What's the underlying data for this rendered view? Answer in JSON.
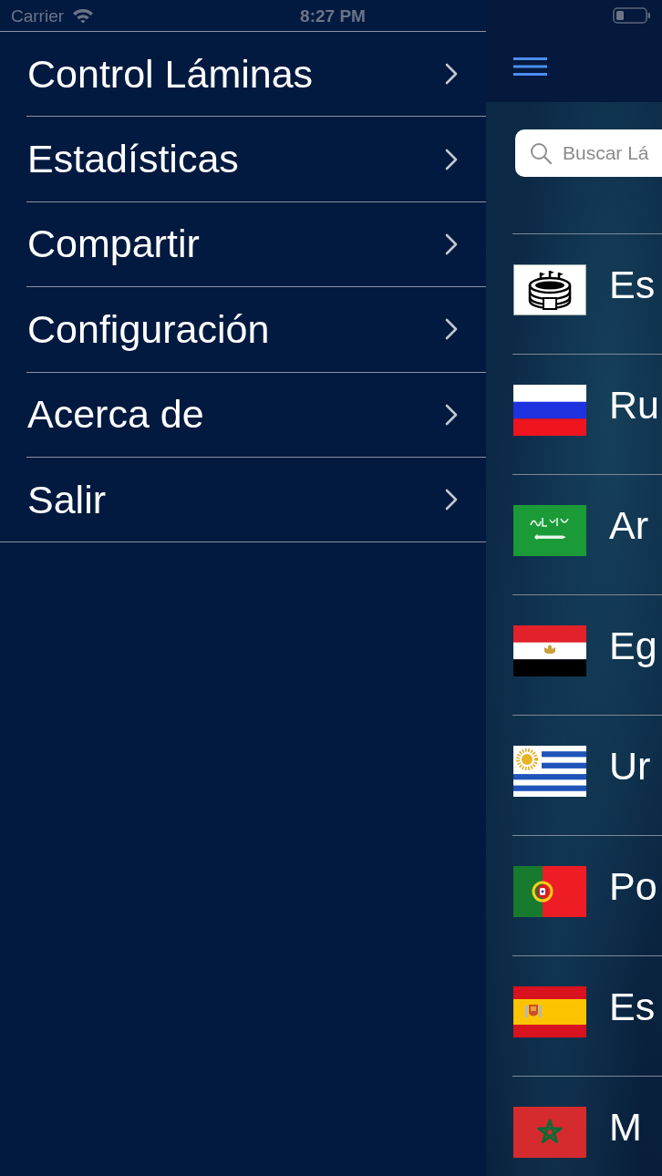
{
  "status_bar": {
    "carrier": "Carrier",
    "time": "8:27 PM"
  },
  "menu": {
    "items": [
      {
        "label": "Control Láminas"
      },
      {
        "label": "Estadísticas"
      },
      {
        "label": "Compartir"
      },
      {
        "label": "Configuración"
      },
      {
        "label": "Acerca de"
      },
      {
        "label": "Salir"
      }
    ]
  },
  "main": {
    "search": {
      "placeholder": "Buscar Lá"
    },
    "rows": [
      {
        "kind": "stadium",
        "name": "Es"
      },
      {
        "kind": "russia",
        "name": "Ru"
      },
      {
        "kind": "saudi",
        "name": "Ar"
      },
      {
        "kind": "egypt",
        "name": "Eg"
      },
      {
        "kind": "uruguay",
        "name": "Ur"
      },
      {
        "kind": "portugal",
        "name": "Po"
      },
      {
        "kind": "spain",
        "name": "Es"
      },
      {
        "kind": "morocco",
        "name": "M"
      }
    ]
  }
}
